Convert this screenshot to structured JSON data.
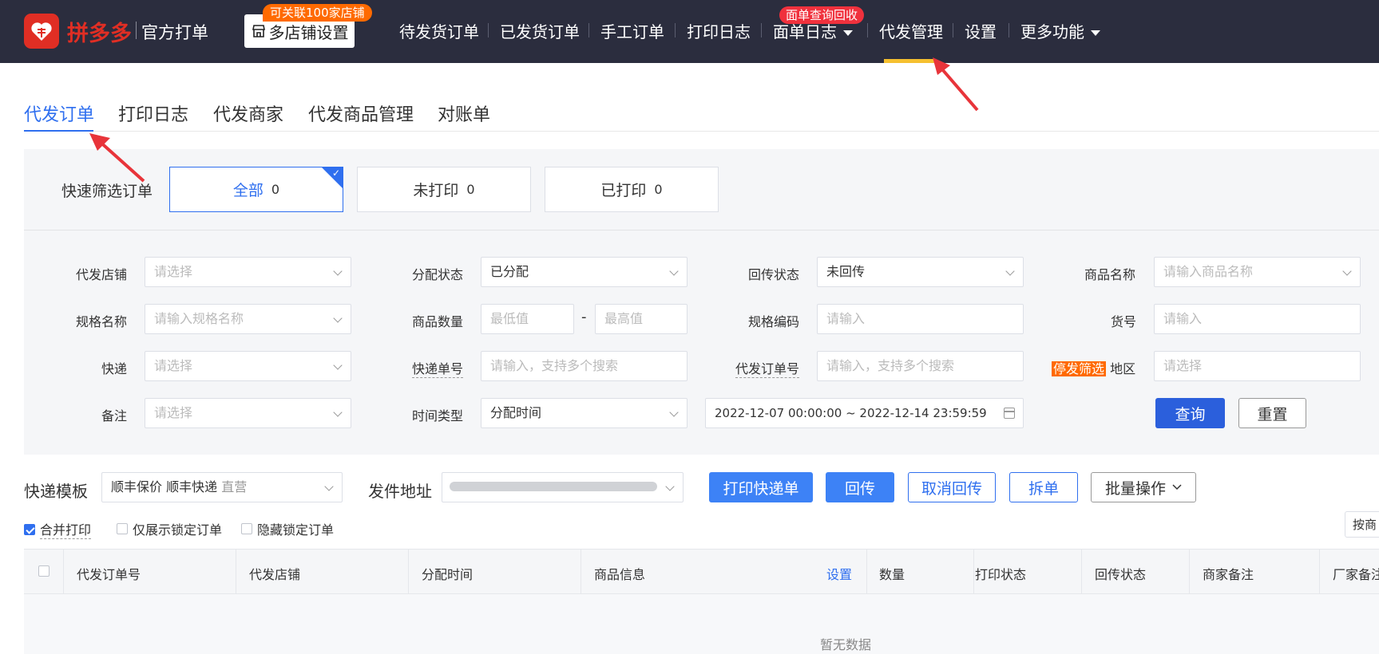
{
  "nav": {
    "logo_text": "拼多多",
    "logo_sub": "官方打单",
    "store_button": "多店铺设置",
    "store_badge": "可关联100家店铺",
    "items": [
      {
        "label": "待发货订单"
      },
      {
        "label": "已发货订单"
      },
      {
        "label": "手工订单"
      },
      {
        "label": "打印日志"
      },
      {
        "label": "面单日志",
        "badge": "面单查询回收"
      },
      {
        "label": "代发管理",
        "active": true
      },
      {
        "label": "设置"
      },
      {
        "label": "更多功能"
      }
    ],
    "active_color": "#f5c02f"
  },
  "subtabs": [
    "代发订单",
    "打印日志",
    "代发商家",
    "代发商品管理",
    "对账单"
  ],
  "quick_filter": {
    "label": "快速筛选订单",
    "cards": [
      {
        "label": "全部",
        "count": "0",
        "selected": true
      },
      {
        "label": "未打印",
        "count": "0"
      },
      {
        "label": "已打印",
        "count": "0"
      }
    ]
  },
  "filters": {
    "shop": {
      "label": "代发店铺",
      "placeholder": "请选择"
    },
    "assign_status": {
      "label": "分配状态",
      "value": "已分配"
    },
    "return_status": {
      "label": "回传状态",
      "value": "未回传"
    },
    "product_name": {
      "label": "商品名称",
      "placeholder": "请输入商品名称"
    },
    "spec_name": {
      "label": "规格名称",
      "placeholder": "请输入规格名称"
    },
    "quantity": {
      "label": "商品数量",
      "min_placeholder": "最低值",
      "max_placeholder": "最高值",
      "separator": "-"
    },
    "spec_code": {
      "label": "规格编码",
      "placeholder": "请输入"
    },
    "item_no": {
      "label": "货号",
      "placeholder": "请输入"
    },
    "express": {
      "label": "快递",
      "placeholder": "请选择"
    },
    "tracking_no": {
      "label": "快递单号",
      "placeholder": "请输入，支持多个搜索"
    },
    "agent_order_no": {
      "label": "代发订单号",
      "placeholder": "请输入，支持多个搜索"
    },
    "region": {
      "tag": "停发筛选",
      "label": "地区",
      "placeholder": "请选择"
    },
    "remark": {
      "label": "备注",
      "placeholder": "请选择"
    },
    "time_type": {
      "label": "时间类型",
      "value": "分配时间"
    },
    "date_range": "2022-12-07 00:00:00 ~ 2022-12-14 23:59:59",
    "query_button": "查询",
    "reset_button": "重置"
  },
  "toolbar": {
    "template_label": "快递模板",
    "template_value": "顺丰保价 顺丰快递",
    "template_tag": "直营",
    "address_label": "发件地址",
    "print_button": "打印快递单",
    "return_button": "回传",
    "cancel_return_button": "取消回传",
    "split_button": "拆单",
    "batch_button": "批量操作",
    "merge_print": {
      "label": "合并打印",
      "checked": true
    },
    "only_locked": {
      "label": "仅展示锁定订单",
      "checked": false
    },
    "hide_locked": {
      "label": "隐藏锁定订单",
      "checked": false
    },
    "sort_button": "按商"
  },
  "table": {
    "headers": [
      "代发订单号",
      "代发店铺",
      "分配时间",
      "商品信息",
      "设置",
      "数量",
      "打印状态",
      "回传状态",
      "商家备注",
      "厂家备注"
    ],
    "empty_text": "暂无数据"
  },
  "colors": {
    "primary": "#2f6fef",
    "brand": "#e02e24",
    "nav_bg": "#2b2d3e",
    "arrow": "#e8343a"
  }
}
